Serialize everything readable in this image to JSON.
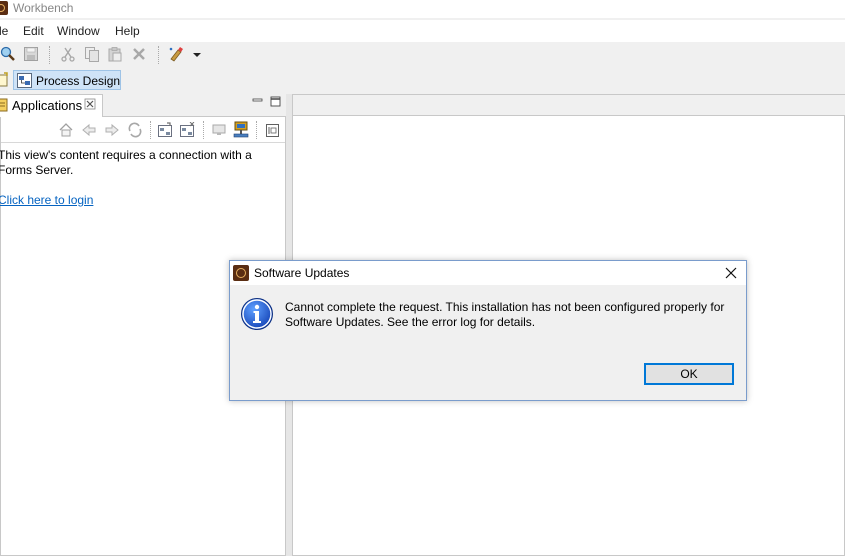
{
  "window": {
    "title": "Workbench"
  },
  "menu": [
    "le",
    "Edit",
    "Window",
    "Help"
  ],
  "toolbar": {
    "icons": [
      "search-icon",
      "save-icon",
      "cut-icon",
      "copy-icon",
      "paste-icon",
      "delete-icon",
      "run-icon",
      "dropdown-arrow-icon"
    ]
  },
  "perspective": {
    "label": "Process Design"
  },
  "view": {
    "tab_label": "Applications",
    "message": "This view's content requires a connection with a Forms Server.",
    "login_link": "Click here to login"
  },
  "dialog": {
    "title": "Software Updates",
    "message": "Cannot complete the request.  This installation has not been configured properly for Software Updates.  See the error log for details.",
    "ok_label": "OK",
    "icon": "info-icon"
  },
  "colors": {
    "link": "#0563c1",
    "perspective_active": "#cfe3f7",
    "button_focus": "#0078d7"
  }
}
